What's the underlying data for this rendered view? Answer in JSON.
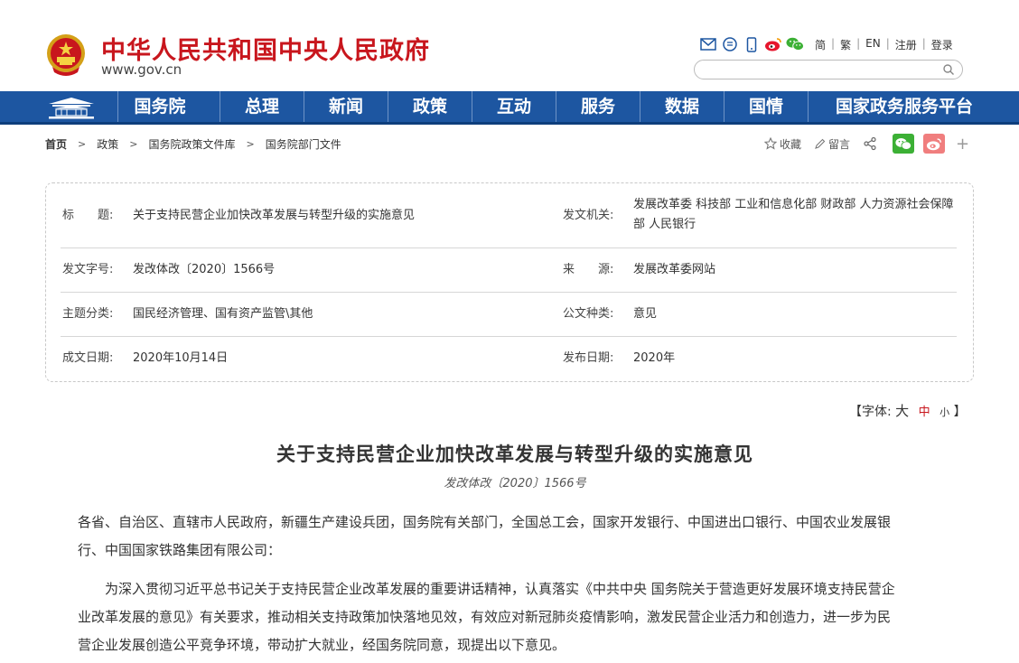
{
  "header": {
    "site_name": "中华人民共和国中央人民政府",
    "site_url": "www.gov.cn",
    "icons": [
      "mail-icon",
      "app-icon",
      "mobile-icon",
      "weibo-icon",
      "wechat-icon"
    ],
    "links": [
      "简",
      "繁",
      "EN",
      "注册",
      "登录"
    ],
    "search_placeholder": ""
  },
  "nav": {
    "items": [
      "国务院",
      "总理",
      "新闻",
      "政策",
      "互动",
      "服务",
      "数据",
      "国情",
      "国家政务服务平台"
    ]
  },
  "breadcrumb": {
    "items": [
      "首页",
      "政策",
      "国务院政策文件库",
      "国务院部门文件"
    ]
  },
  "share": {
    "collect": "收藏",
    "comment": "留言",
    "plus": "+"
  },
  "info": {
    "title_label": "标　　题:",
    "title_value": "关于支持民营企业加快改革发展与转型升级的实施意见",
    "issuer_label": "发文机关:",
    "issuer_value": "发展改革委  科技部  工业和信息化部  财政部  人力资源社会保障部  人民银行",
    "docno_label": "发文字号:",
    "docno_value": "发改体改〔2020〕1566号",
    "source_label": "来　　源:",
    "source_value": "发展改革委网站",
    "topic_label": "主题分类:",
    "topic_value": "国民经济管理、国有资产监管\\其他",
    "type_label": "公文种类:",
    "type_value": "意见",
    "date_label": "成文日期:",
    "date_value": "2020年10月14日",
    "pub_label": "发布日期:",
    "pub_value": "2020年"
  },
  "font_size": {
    "open": "【字体:",
    "big": "大",
    "mid": "中",
    "small": "小",
    "close": "】"
  },
  "article": {
    "title": "关于支持民营企业加快改革发展与转型升级的实施意见",
    "doc_number": "发改体改〔2020〕1566号",
    "p1_line1": "各省、自治区、直辖市人民政府，新疆生产建设兵团，国务院有关部门，全国总工会，国家开发银行、中国进出口银行、中国农业发展银",
    "p1_line2": "行、中国国家铁路集团有限公司：",
    "p2_line1": "　　为深入贯彻习近平总书记关于支持民营企业改革发展的重要讲话精神，认真落实《中共中央 国务院关于营造更好发展环境支持民营企",
    "p2_line2": "业改革发展的意见》有关要求，推动相关支持政策加快落地见效，有效应对新冠肺炎疫情影响，激发民营企业活力和创造力，进一步为民",
    "p2_line3": "营企业发展创造公平竞争环境，带动扩大就业，经国务院同意，现提出以下意见。"
  },
  "colors": {
    "brand_red": "#c8161d",
    "nav_blue": "#1d56a1"
  }
}
